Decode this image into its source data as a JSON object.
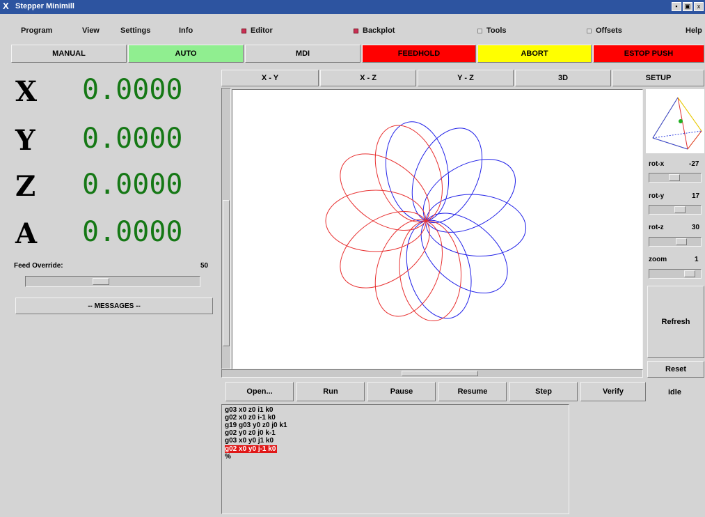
{
  "window": {
    "title": "Stepper Minimill",
    "controls": [
      "▪",
      "▣",
      "x"
    ]
  },
  "menubar": {
    "program": "Program",
    "view": "View",
    "settings": "Settings",
    "info": "Info",
    "editor": "Editor",
    "backplot": "Backplot",
    "tools": "Tools",
    "offsets": "Offsets",
    "help": "Help"
  },
  "modes": {
    "manual": "MANUAL",
    "auto": "AUTO",
    "mdi": "MDI",
    "feedhold": "FEEDHOLD",
    "abort": "ABORT",
    "estop": "ESTOP PUSH"
  },
  "colors": {
    "auto_active": "#90ee90",
    "feedhold": "#ff0000",
    "abort": "#ffff00",
    "estop": "#ff0000",
    "position_text": "#157815"
  },
  "axes": [
    {
      "name": "X",
      "value": "0.0000"
    },
    {
      "name": "Y",
      "value": "0.0000"
    },
    {
      "name": "Z",
      "value": "0.0000"
    },
    {
      "name": "A",
      "value": "0.0000"
    }
  ],
  "feed": {
    "label": "Feed Override:",
    "value": "50",
    "percent": 50
  },
  "messages_button": "-- MESSAGES --",
  "views": {
    "xy": "X - Y",
    "xz": "X - Z",
    "yz": "Y - Z",
    "d3": "3D",
    "setup": "SETUP"
  },
  "rotation": {
    "rotx": {
      "label": "rot-x",
      "value": "-27"
    },
    "roty": {
      "label": "rot-y",
      "value": "17"
    },
    "rotz": {
      "label": "rot-z",
      "value": "30"
    },
    "zoom": {
      "label": "zoom",
      "value": "1"
    }
  },
  "refresh": "Refresh",
  "reset": "Reset",
  "program_buttons": {
    "open": "Open...",
    "run": "Run",
    "pause": "Pause",
    "resume": "Resume",
    "step": "Step",
    "verify": "Verify",
    "status": "idle"
  },
  "gcode": [
    "g03 x0 z0 i1 k0",
    "g02 x0 z0 i-1 k0",
    "g19 g03 y0 z0 j0 k1",
    "g02 y0 z0 j0 k-1",
    "g03 x0 y0 j1 k0",
    "g02 x0 y0 j-1 k0",
    "%"
  ],
  "gcode_current_line": 5,
  "icons": {
    "x_logo": "x-logo-icon",
    "checkbox_on": "checkbox-checked-icon",
    "checkbox_off": "checkbox-unchecked-icon"
  }
}
